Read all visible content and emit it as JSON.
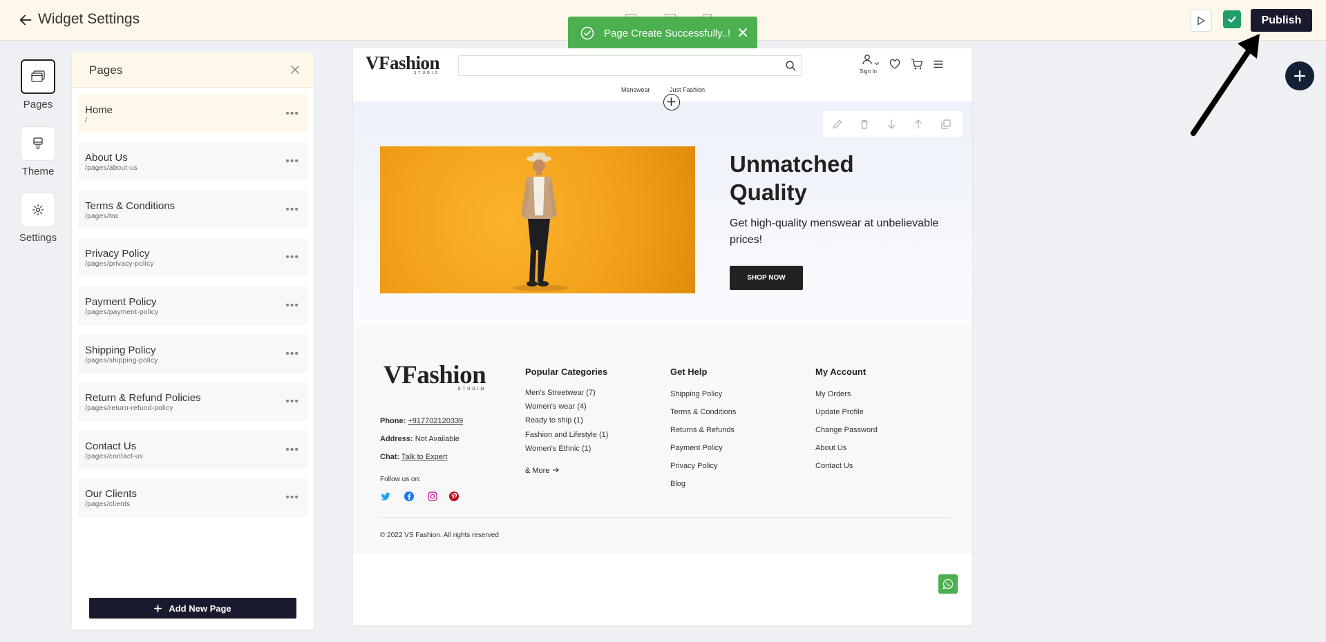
{
  "topbar": {
    "title": "Widget Settings",
    "publish_label": "Publish"
  },
  "toast": {
    "message": "Page Create Successfully..!"
  },
  "rail": {
    "items": [
      {
        "label": "Pages",
        "icon": "pages-icon"
      },
      {
        "label": "Theme",
        "icon": "theme-icon"
      },
      {
        "label": "Settings",
        "icon": "gear-icon"
      }
    ]
  },
  "pages_panel": {
    "title": "Pages",
    "add_label": "Add New Page",
    "items": [
      {
        "name": "Home",
        "path": "/"
      },
      {
        "name": "About Us",
        "path": "/pages/about-us"
      },
      {
        "name": "Terms & Conditions",
        "path": "/pages/tnc"
      },
      {
        "name": "Privacy Policy",
        "path": "/pages/privacy-policy"
      },
      {
        "name": "Payment Policy",
        "path": "/pages/payment-policy"
      },
      {
        "name": "Shipping Policy",
        "path": "/pages/shipping-policy"
      },
      {
        "name": "Return & Refund Policies",
        "path": "/pages/return-refund-policy"
      },
      {
        "name": "Contact Us",
        "path": "/pages/contact-us"
      },
      {
        "name": "Our Clients",
        "path": "/pages/clients"
      }
    ]
  },
  "preview": {
    "logo_main": "VFashion",
    "logo_sub": "STUDIO",
    "signin": "Sign In",
    "nav": [
      "Menswear",
      "Just Fashion"
    ],
    "hero": {
      "title": "Unmatched Quality",
      "subtitle": "Get high-quality menswear at unbelievable prices!",
      "cta": "SHOP NOW"
    },
    "footer": {
      "phone_label": "Phone:",
      "phone": "+917702120339",
      "address_label": "Address:",
      "address": "Not Available",
      "chat_label": "Chat:",
      "chat": "Talk to Expert",
      "follow": "Follow us on:",
      "columns": [
        {
          "title": "Popular Categories",
          "links": [
            "Men's Streetwear (7)",
            "Women's wear (4)",
            "Ready to ship (1)",
            "Fashion and Lifestyle (1)",
            "Women's Ethnic (1)"
          ]
        },
        {
          "title": "Get Help",
          "links": [
            "Shipping Policy",
            "Terms & Conditions",
            "Returns & Refunds",
            "Payment Policy",
            "Privacy Policy",
            "Blog"
          ]
        },
        {
          "title": "My Account",
          "links": [
            "My Orders",
            "Update Profile",
            "Change Password",
            "About Us",
            "Contact Us"
          ]
        }
      ],
      "more": "& More",
      "copyright": "© 2022 VS Fashion. All rights reserved"
    }
  },
  "colors": {
    "topbar_bg": "#fdf8ea",
    "primary_dark": "#1a1a2e",
    "toast_green": "#4caf50",
    "check_green": "#1f9d6b",
    "hero_orange": "#f29f18"
  }
}
